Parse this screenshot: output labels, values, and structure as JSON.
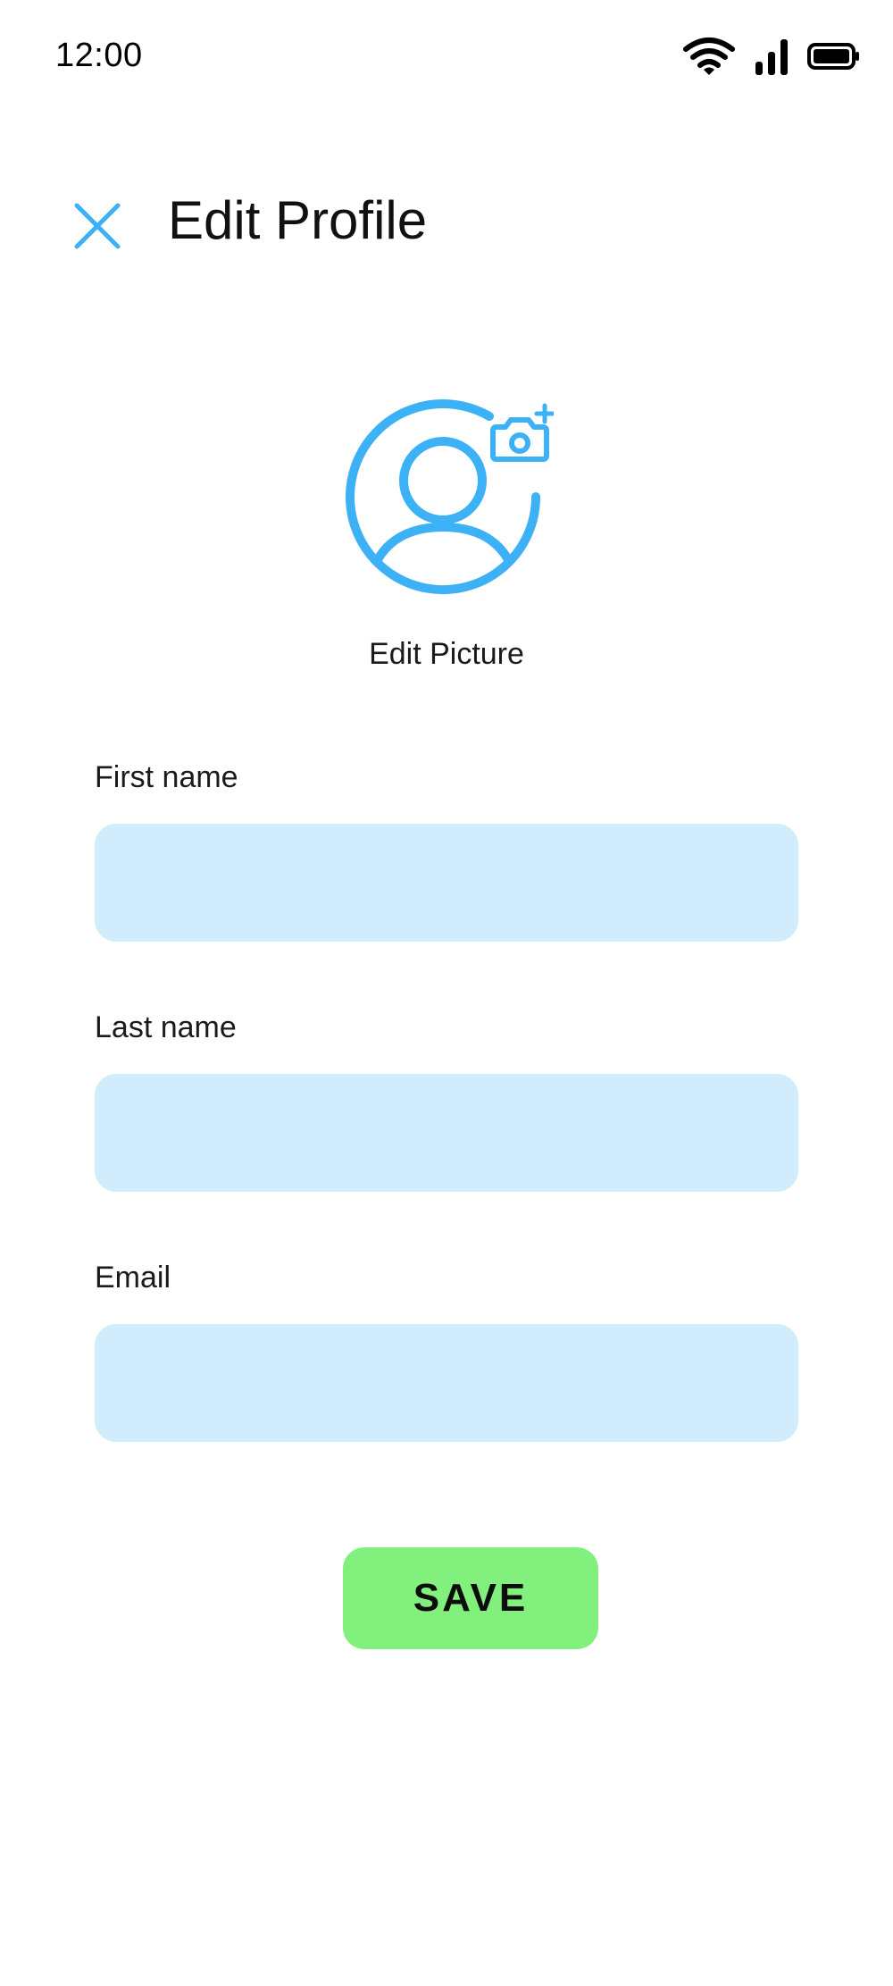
{
  "status_bar": {
    "time": "12:00",
    "icons": [
      "wifi-icon",
      "signal-icon",
      "battery-icon"
    ]
  },
  "header": {
    "close_icon": "close-icon",
    "title": "Edit Profile"
  },
  "avatar": {
    "icon": "user-avatar-icon",
    "edit_icon": "camera-add-icon",
    "edit_label": "Edit Picture"
  },
  "form": {
    "first_name": {
      "label": "First name",
      "value": "",
      "placeholder": ""
    },
    "last_name": {
      "label": "Last name",
      "value": "",
      "placeholder": ""
    },
    "email": {
      "label": "Email",
      "value": "",
      "placeholder": ""
    }
  },
  "actions": {
    "save_label": "SAVE"
  },
  "colors": {
    "accent": "#3db1f5",
    "input_background": "#d1ecfc",
    "save_button": "#82f07c",
    "background": "#ffffff"
  }
}
